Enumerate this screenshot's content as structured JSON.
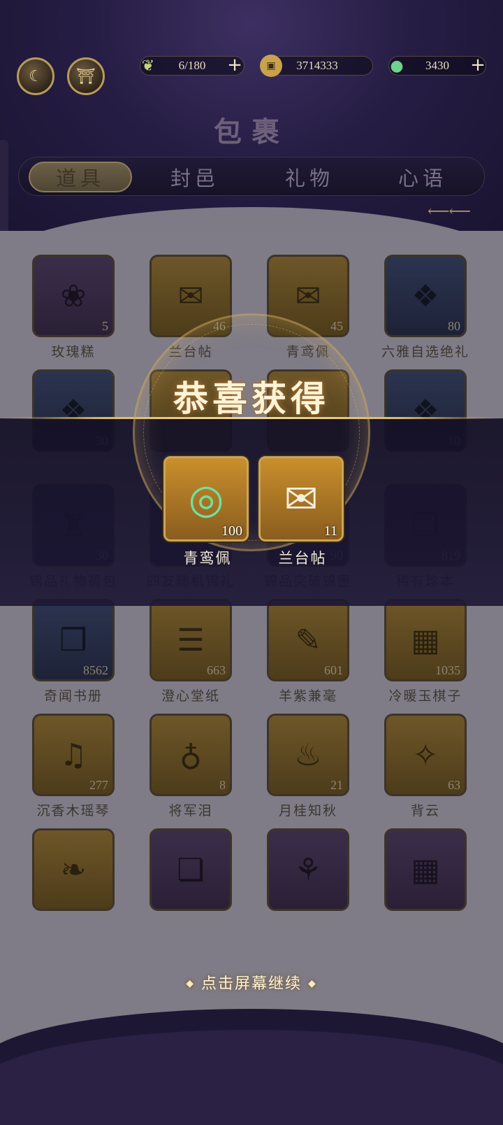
{
  "header": {
    "title": "包裹",
    "resources": [
      {
        "icon": "leaf-stamina-icon",
        "value": "6/180",
        "has_plus": true
      },
      {
        "icon": "copper-coin-icon",
        "value": "3714333",
        "has_plus": false
      },
      {
        "icon": "jade-gem-icon",
        "value": "3430",
        "has_plus": true
      }
    ]
  },
  "tabs": [
    {
      "label": "道具",
      "active": true
    },
    {
      "label": "封邑",
      "active": false
    },
    {
      "label": "礼物",
      "active": false
    },
    {
      "label": "心语",
      "active": false
    }
  ],
  "inventory": [
    {
      "name": "玫瑰糕",
      "count": "5",
      "icon": "rose-cake-icon",
      "frame": "purple"
    },
    {
      "name": "兰台帖",
      "count": "46",
      "icon": "letter-scroll-icon",
      "frame": "gold"
    },
    {
      "name": "青鸢佩",
      "count": "45",
      "icon": "letter-scroll-icon",
      "frame": "gold"
    },
    {
      "name": "六雅自选绝礼",
      "count": "80",
      "icon": "gift-box-icon",
      "frame": "blue"
    },
    {
      "name": "",
      "count": "30",
      "icon": "gift-box-icon",
      "frame": "blue"
    },
    {
      "name": "",
      "count": "",
      "icon": "",
      "frame": "gold"
    },
    {
      "name": "",
      "count": "",
      "icon": "",
      "frame": "gold"
    },
    {
      "name": "",
      "count": "10",
      "icon": "gift-box-icon",
      "frame": "blue"
    },
    {
      "name": "锦品礼物荷包",
      "count": "30",
      "icon": "pouch-icon",
      "frame": "blue"
    },
    {
      "name": "四友随机锦礼",
      "count": "10",
      "icon": "chest-icon",
      "frame": "blue"
    },
    {
      "name": "锦品突破锦匣",
      "count": "90",
      "icon": "chest-icon",
      "frame": "blue"
    },
    {
      "name": "稀有珍本",
      "count": "819",
      "icon": "rare-book-icon",
      "frame": "purple"
    },
    {
      "name": "奇闻书册",
      "count": "8562",
      "icon": "book-icon",
      "frame": "blue"
    },
    {
      "name": "澄心堂纸",
      "count": "663",
      "icon": "paper-icon",
      "frame": "gold"
    },
    {
      "name": "羊紫兼毫",
      "count": "601",
      "icon": "brush-icon",
      "frame": "gold"
    },
    {
      "name": "冷暖玉棋子",
      "count": "1035",
      "icon": "go-board-icon",
      "frame": "gold"
    },
    {
      "name": "沉香木瑶琴",
      "count": "277",
      "icon": "zither-icon",
      "frame": "gold"
    },
    {
      "name": "将军泪",
      "count": "8",
      "icon": "perfume-bottle-icon",
      "frame": "gold"
    },
    {
      "name": "月桂知秋",
      "count": "21",
      "icon": "incense-icon",
      "frame": "gold"
    },
    {
      "name": "背云",
      "count": "63",
      "icon": "jewel-fan-icon",
      "frame": "gold"
    },
    {
      "name": "",
      "count": "",
      "icon": "feather-icon",
      "frame": "gold"
    },
    {
      "name": "",
      "count": "",
      "icon": "scroll-icon",
      "frame": "purple"
    },
    {
      "name": "",
      "count": "",
      "icon": "hairpin-icon",
      "frame": "purple"
    },
    {
      "name": "",
      "count": "",
      "icon": "go-board-icon",
      "frame": "purple"
    }
  ],
  "reward_popup": {
    "title": "恭喜获得",
    "items": [
      {
        "name": "青鸾佩",
        "count": "100",
        "icon": "jade-pendant-icon"
      },
      {
        "name": "兰台帖",
        "count": "11",
        "icon": "letter-scroll-icon"
      }
    ],
    "continue_hint": "点击屏幕继续"
  }
}
